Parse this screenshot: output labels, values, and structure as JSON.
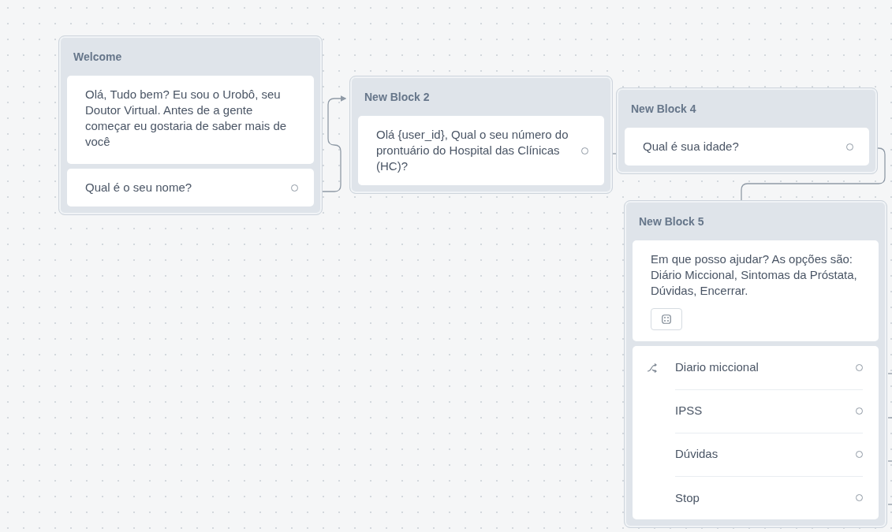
{
  "blocks": [
    {
      "title": "Welcome",
      "items": [
        {
          "kind": "text",
          "text": "Olá, Tudo bem? Eu sou o Urobô, seu Doutor Virtual. Antes de a gente começar eu gostaria de saber mais de você"
        },
        {
          "kind": "input",
          "text": "Qual é o seu nome?"
        }
      ]
    },
    {
      "title": "New Block 2",
      "items": [
        {
          "kind": "input",
          "text": "Olá {user_id}, Qual o seu número do prontuário do Hospital das Clínicas (HC)?"
        }
      ]
    },
    {
      "title": "New Block 4",
      "items": [
        {
          "kind": "input",
          "text": "Qual é sua idade?"
        }
      ]
    },
    {
      "title": "New Block 5",
      "items": [
        {
          "kind": "prompt",
          "text": "Em que posso ajudar? As opções são: Diário Miccional, Sintomas da Próstata, Dúvidas, Encerrar."
        },
        {
          "kind": "choices",
          "options": [
            {
              "label": "Diario miccional"
            },
            {
              "label": "IPSS"
            },
            {
              "label": "Dúvidas"
            },
            {
              "label": "Stop"
            }
          ]
        }
      ]
    }
  ]
}
